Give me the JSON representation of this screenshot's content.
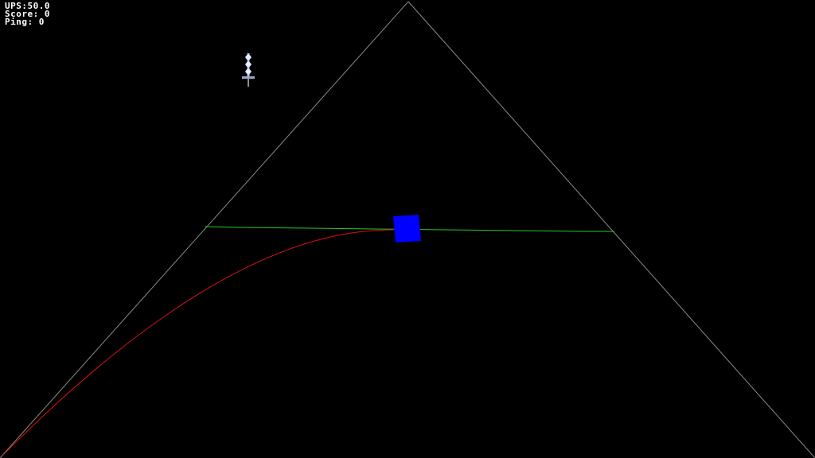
{
  "hud": {
    "ups": "UPS:50.0",
    "score": "Score: 0",
    "ping": "Ping: 0"
  },
  "colors": {
    "background": "#000000",
    "pyramid_edge": "#8a8a8a",
    "horizon_line": "#22cc22",
    "trajectory": "#dd1111",
    "player_cube": "#0000ff",
    "sword": "#c8d0e8"
  },
  "icons": {
    "sword": "sword-icon"
  }
}
